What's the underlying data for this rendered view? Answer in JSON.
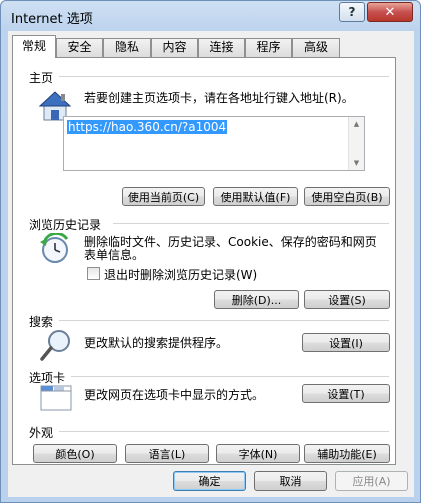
{
  "window": {
    "title": "Internet 选项",
    "help_label": "?",
    "close_label": "✕"
  },
  "tabs": [
    {
      "label": "常规"
    },
    {
      "label": "安全"
    },
    {
      "label": "隐私"
    },
    {
      "label": "内容"
    },
    {
      "label": "连接"
    },
    {
      "label": "程序"
    },
    {
      "label": "高级"
    }
  ],
  "home": {
    "section_label": "主页",
    "description": "若要创建主页选项卡，请在各地址行键入地址(R)。",
    "url": "https://hao.360.cn/?a1004",
    "btn_current": "使用当前页(C)",
    "btn_default": "使用默认值(F)",
    "btn_blank": "使用空白页(B)"
  },
  "history": {
    "section_label": "浏览历史记录",
    "description_line1": "删除临时文件、历史记录、Cookie、保存的密码和网页",
    "description_line2": "表单信息。",
    "checkbox_label": "退出时删除浏览历史记录(W)",
    "btn_delete": "删除(D)...",
    "btn_settings": "设置(S)"
  },
  "search": {
    "section_label": "搜索",
    "description": "更改默认的搜索提供程序。",
    "btn_settings": "设置(I)"
  },
  "tabs_section": {
    "section_label": "选项卡",
    "description": "更改网页在选项卡中显示的方式。",
    "btn_settings": "设置(T)"
  },
  "appearance": {
    "section_label": "外观",
    "btn_colors": "颜色(O)",
    "btn_languages": "语言(L)",
    "btn_fonts": "字体(N)",
    "btn_accessibility": "辅助功能(E)"
  },
  "footer": {
    "btn_ok": "确定",
    "btn_cancel": "取消",
    "btn_apply": "应用(A)"
  }
}
